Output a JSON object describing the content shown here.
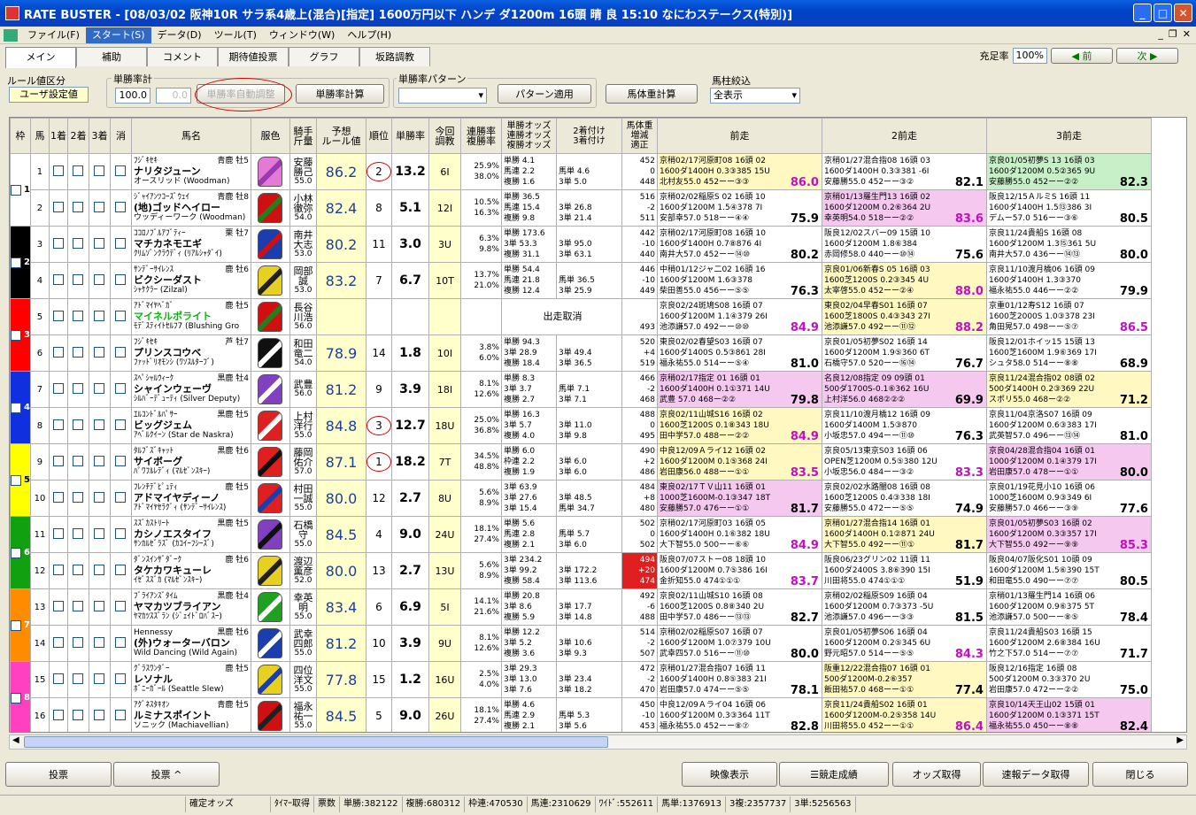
{
  "window": {
    "title": "RATE BUSTER - [08/03/02 阪神10R サラ系4歳上(混合)[指定] 1600万円以下 ハンデ ダ1200m 16頭 晴 良 15:10 なにわステークス(特別)]"
  },
  "menu": [
    "ファイル(F)",
    "スタート(S)",
    "データ(D)",
    "ツール(T)",
    "ウィンドウ(W)",
    "ヘルプ(H)"
  ],
  "menu_active": "スタート(S)",
  "tabs": [
    "メイン",
    "補助",
    "コメント",
    "期待値投票",
    "グラフ",
    "坂路調教"
  ],
  "topright": {
    "label": "充足率",
    "value": "100%",
    "prev": "◀ 前",
    "next": "次 ▶"
  },
  "controls": {
    "rule_label": "ルール値区分",
    "rule_value": "ユーザ設定値",
    "rate_label": "単勝率計",
    "rate_value": "100.0",
    "rate_value2": "0.0",
    "auto_button": "単勝率自動調整",
    "calc_button": "単勝率計算",
    "pattern_label": "単勝率パターン",
    "pattern_apply": "パターン適用",
    "weight_button": "馬体重計算",
    "filter_label": "馬柱絞込",
    "filter_value": "全表示"
  },
  "headers": [
    "枠",
    "馬",
    "1着",
    "2着",
    "3着",
    "消",
    "馬名",
    "服色",
    "騎手\n斤量",
    "予想\nルール値",
    "順位",
    "単勝率",
    "今回\n調教",
    "連勝率\n複勝率",
    "単勝オッズ\n連勝オッズ\n複勝オッズ",
    "2着付け\n3着付け",
    "馬体重\n増減\n適正",
    "前走",
    "2前走",
    "3前走"
  ],
  "horses": [
    {
      "waku": "1",
      "wcolor": "#ffffff",
      "wtext": "#000",
      "num": "1",
      "sire": "ﾌｼﾞｷｾｷ",
      "sex": "青鹿 牡5",
      "name": "ナリタジューン",
      "dam": "オースリッド (Woodman)",
      "jockey": "安藤\n勝己",
      "kin": "55.0",
      "rule": "86.2",
      "rank": "2",
      "rank_circle": true,
      "rate": "13.2",
      "chokyo": "6I",
      "ren": "25.9%\n38.0%",
      "odds": "単勝 4.1\n馬連 2.2\n複勝 1.6",
      "tsuke": "\n馬単 4.6\n3単 5.0",
      "weight": "452\n0\n448",
      "wcolor2": "",
      "silk": [
        "#e27ad6",
        "#9a3ab0"
      ],
      "r1": "京稍02/17河原町08 16頭 02\n1600ダ1400H 0.3③385 15U\n北村友55.0 452ーー③③",
      "p1": "86.0",
      "c1": "#fff8c0",
      "r2": "京稍01/27混合指08 16頭 03\n1600ダ1400H 0.3③381 -6I\n安藤勝55.0 452ーー③②",
      "p2": "82.1",
      "c2": "#ffffff",
      "r3": "京良01/05初夢S 13 16頭 03\n1600ダ1200M 0.5②365 9U\n安藤勝55.0 452ーー②②",
      "p3": "82.3",
      "c3": "#c8f0c8"
    },
    {
      "waku": "1",
      "wcolor": "#ffffff",
      "wtext": "#000",
      "num": "2",
      "sire": "ｼﾞｬｲｱﾝﾂｺｰｽﾞｳｪｲ",
      "sex": "青鹿 牡8",
      "name": "(地)ゴッドヘイロー",
      "dam": "ウッディーワーク (Woodman)",
      "jockey": "小林\n徹弥",
      "kin": "54.0",
      "rule": "82.4",
      "rank": "8",
      "rank_circle": false,
      "rate": "5.1",
      "chokyo": "12I",
      "ren": "10.5%\n16.3%",
      "odds": "単勝 36.5\n馬連 15.4\n複勝 9.8",
      "tsuke": "\n3単 26.8\n3単 21.4",
      "weight": "516\n-2\n511",
      "wcolor2": "",
      "silk": [
        "#d01010",
        "#208020"
      ],
      "r1": "京稍02/02稲原S 02 16頭 10\n1600ダ1200M 1.5④378 7I\n安部幸57.0 518ーー④④",
      "p1": "75.9",
      "c1": "#ffffff",
      "r2": "京稍01/13羅生門13 16頭 02\n1600ダ1200M 0.2⑥364 2U\n幸英明54.0 518ーー②②",
      "p2": "83.6",
      "c2": "#f5c8f0",
      "r3": "阪良12/15ＡルミS 16頭 11\n1600ダ1400H 1.5⑬386 3I\nデムー57.0 516ーー③⑥",
      "p3": "80.5",
      "c3": "#ffffff"
    },
    {
      "waku": "2",
      "wcolor": "#000000",
      "wtext": "#fff",
      "num": "3",
      "sire": "ｺｺﾛﾉﾌﾞﾙｱﾌﾞﾃｨｰ",
      "sex": "栗 牡7",
      "name": "マチカネモエギ",
      "dam": "ｸﾘﾑｿﾞﾝｸﾗｳﾃﾞｨ (ﾘｱﾙｼｬﾀﾞｲ)",
      "jockey": "南井\n大志",
      "kin": "53.0",
      "rule": "80.2",
      "rank": "11",
      "rank_circle": false,
      "rate": "3.0",
      "chokyo": "3U",
      "ren": "6.3%\n9.8%",
      "odds": "単勝 173.6\n3単 53.3\n複勝 31.1",
      "tsuke": "\n3単 95.0\n3単 63.1",
      "weight": "442\n-10\n440",
      "wcolor2": "",
      "silk": [
        "#1a3db0",
        "#d01010"
      ],
      "r1": "京稍02/17河原町08 16頭 10\n1600ダ1400H 0.7⑧876 4I\n南井大57.0 452ーー⑭⑩",
      "p1": "80.2",
      "c1": "#ffffff",
      "r2": "阪良12/02スバー09 15頭 10\n1600ダ1200M 1.8⑥384\n赤岡修58.0 440ーー⑩⑭",
      "p2": "75.6",
      "c2": "#ffffff",
      "r3": "京良11/24貴船S 16頭 08\n1600ダ1200M 1.3⑮361 5U\n南井大57.0 436ーー⑭⑬",
      "p3": "80.0",
      "c3": "#ffffff"
    },
    {
      "waku": "2",
      "wcolor": "#000000",
      "wtext": "#fff",
      "num": "4",
      "sire": "ｻﾝﾃﾞｰｻｲﾚﾝｽ",
      "sex": "鹿 牡6",
      "name": "ビクシーダスト",
      "dam": "ｼｬｹｸﾗｰ (Zilzal)",
      "jockey": "岡部\n誠",
      "kin": "53.0",
      "rule": "83.2",
      "rank": "7",
      "rank_circle": false,
      "rate": "6.7",
      "chokyo": "10T",
      "ren": "13.7%\n21.0%",
      "odds": "単勝 54.4\n馬連 21.8\n複勝 12.4",
      "tsuke": "\n馬単 36.5\n3単 25.9",
      "weight": "446\n-10\n449",
      "wcolor2": "",
      "silk": [
        "#e8d020",
        "#202020"
      ],
      "r1": "中稍01/12ジャ二02 16頭 16\n1600ダ1200M 1.6③378\n柴田善55.0 456ーー⑤⑤",
      "p1": "76.3",
      "c1": "#ffffff",
      "r2": "京良01/06新春S 05 16頭 03\n1600芝1200S 0.2③345 4U\n太宰啓55.0 452ーー②④",
      "p2": "88.0",
      "c2": "#fff8c0",
      "r3": "京良11/10渡月橋06 16頭 09\n1600ダ1400H 1.3③370\n福永祐55.0 446ーー②②",
      "p3": "79.9",
      "c3": "#ffffff"
    },
    {
      "waku": "3",
      "wcolor": "#ff0000",
      "wtext": "#fff",
      "num": "5",
      "sire": "ｱﾄﾞﾏｲﾔﾍﾞｶﾞ",
      "sex": "鹿 牡5",
      "name": "マイネルポライト",
      "dam": "ﾓﾃﾞｽﾃｨｲﾄｾﾙﾌ7 (Blushing Gro",
      "jockey": "長谷\n川浩",
      "kin": "56.0",
      "rule": "",
      "rank": "",
      "rank_circle": false,
      "rate": "",
      "chokyo": "",
      "ren": "",
      "odds": "出走取消",
      "tsuke": "",
      "weight": "\n\n493",
      "wcolor2": "",
      "silk": [
        "#d01010",
        "#208020"
      ],
      "r1": "京良02/24斑鳩S08 16頭 07\n1600ダ1200M 1.1④379 26I\n池添謙57.0 492ーー⑩⑩",
      "p1": "84.9",
      "c1": "#ffffff",
      "r2": "東良02/04早春S01 16頭 07\n1600芝1800S 0.4③343 27I\n池添謙57.0 492ーー⑪⑫",
      "p2": "88.2",
      "c2": "#fff8c0",
      "r3": "京重01/12寿S12 16頭 07\n1600芝2000S 1.0③378 23I\n角田晃57.0 498ーー⑤⑦",
      "p3": "86.5",
      "c3": "#ffffff"
    },
    {
      "waku": "3",
      "wcolor": "#ff0000",
      "wtext": "#fff",
      "num": "6",
      "sire": "ﾌｼﾞｷｾｷ",
      "sex": "芦 牡7",
      "name": "プリンスコウベ",
      "dam": "ﾌｧｯﾄﾞﾘｵﾓﾝｼ (ﾜｿｽﾙﾀｰﾌﾞ)",
      "jockey": "和田\n竜二",
      "kin": "54.0",
      "rule": "78.9",
      "rank": "14",
      "rank_circle": false,
      "rate": "1.8",
      "chokyo": "10I",
      "ren": "3.8%\n6.0%",
      "odds": "単勝 94.3\n3単 28.9\n複勝 18.4",
      "tsuke": "\n3単 49.4\n3単 36.5",
      "weight": "520\n+4\n519",
      "wcolor2": "",
      "silk": [
        "#101010",
        "#ffffff"
      ],
      "r1": "東良02/02春望S03 16頭 07\n1600ダ1400S 0.5③861 28I\n福永祐55.0 514ーー⑤④",
      "p1": "81.0",
      "c1": "#ffffff",
      "r2": "京良01/05初夢S02 16頭 14\n1600ダ1200M 1.9⑤360 6T\n石橋守57.0 520ーー⑯⑭",
      "p2": "76.7",
      "c2": "#ffffff",
      "r3": "阪良12/01ホイッ15 15頭 13\n1600芝1600M 1.9⑥369 17I\nシュタ58.0 514ーー⑧⑧",
      "p3": "68.9",
      "c3": "#ffffff"
    },
    {
      "waku": "4",
      "wcolor": "#1030e0",
      "wtext": "#fff",
      "num": "7",
      "sire": "ｽﾍﾟｼｬﾙｳｨｰｸ",
      "sex": "黒鹿 牡4",
      "name": "シャインウェーヴ",
      "dam": "ｼﾙﾊﾞｰﾃﾞｭｰﾃｨ (Silver Deputy)",
      "jockey": "武豊",
      "kin": "56.0",
      "rule": "81.2",
      "rank": "9",
      "rank_circle": false,
      "rate": "3.9",
      "chokyo": "18I",
      "ren": "8.1%\n12.6%",
      "odds": "単勝 8.3\n3単 3.7\n複勝 2.7",
      "tsuke": "\n馬単 7.1\n3単 7.1",
      "weight": "466\n-2\n468",
      "wcolor2": "",
      "silk": [
        "#8040c0",
        "#ffffff"
      ],
      "r1": "京稍02/17指定 01 16頭 01\n1600ダ1400H 0.1①371 14U\n武豊 57.0 468ー②②",
      "p1": "79.8",
      "c1": "#f5c8f0",
      "r2": "名良12/08指定 09 09頭 01\n500ダ1700S-0.1⑥362 16U\n上村洋56.0 468②②②",
      "p2": "69.9",
      "c2": "#f5c8f0",
      "r3": "京良11/24混合指02 08頭 02\n500ダ1400H 0.2③369 22U\nスポリ55.0 468ー②②",
      "p3": "71.2",
      "c3": "#fff8c0"
    },
    {
      "waku": "4",
      "wcolor": "#1030e0",
      "wtext": "#fff",
      "num": "8",
      "sire": "ｴﾙｺﾝﾄﾞﾙﾊﾟｻｰ",
      "sex": "黒鹿 牡5",
      "name": "ビッグジェム",
      "dam": "ｱﾍﾞﾙｸｲｰﾝ (Star de Naskra)",
      "jockey": "上村\n洋行",
      "kin": "55.0",
      "rule": "84.8",
      "rank": "3",
      "rank_circle": true,
      "rate": "12.7",
      "chokyo": "18U",
      "ren": "25.0%\n36.8%",
      "odds": "単勝 16.3\n3単 5.7\n複勝 4.0",
      "tsuke": "\n3単 11.0\n3単 9.8",
      "weight": "488\n0\n495",
      "wcolor2": "",
      "silk": [
        "#e02020",
        "#ffffff"
      ],
      "r1": "京良02/11山城S16 16頭 02\n1600芝1200S 0.1⑧343 18U\n田中学57.0 488ーー②②",
      "p1": "84.9",
      "c1": "#fff8c0",
      "r2": "京良11/10渡月橋12 16頭 09\n1600ダ1400M 1.5③870\n小坂忠57.0 494ーー⑪⑩",
      "p2": "76.3",
      "c2": "#ffffff",
      "r3": "京良11/04京洛S07 16頭 09\n1600ダ1200M 0.6③383 17I\n武英智57.0 496ーー⑬⑭",
      "p3": "81.0",
      "c3": "#ffffff"
    },
    {
      "waku": "5",
      "wcolor": "#ffff00",
      "wtext": "#000",
      "num": "9",
      "sire": "ﾀﾙﾌﾞｽﾞｷｬｯﾄ",
      "sex": "黒鹿 牡6",
      "name": "サイボーグ",
      "dam": "ﾊﾟﾜﾌﾙﾚﾃﾞｨ (ﾏﾙｾﾞﾝｽｷｰ)",
      "jockey": "藤岡\n佑介",
      "kin": "57.0",
      "rule": "87.1",
      "rank": "1",
      "rank_circle": true,
      "rate": "18.2",
      "chokyo": "7T",
      "ren": "34.5%\n48.8%",
      "odds": "単勝 6.0\n枠連 2.2\n複勝 1.9",
      "tsuke": "\n3単 6.0\n3単 6.0",
      "weight": "490\n+2\n486",
      "wcolor2": "",
      "silk": [
        "#e02020",
        "#101010"
      ],
      "r1": "中良12/09Ａライ12 16頭 02\n1600ダ1200M 0.1⑤368 24I\n岩田康56.0 488ーー①①",
      "p1": "83.5",
      "c1": "#fff8c0",
      "r2": "京良05/13東京S03 16頭 06\nOPEN芝1200M 0.5⑤380 12U\n小坂忠56.0 484ーー③②",
      "p2": "83.3",
      "c2": "#ffffff",
      "r3": "京良04/28混合指04 16頭 01\n1000ダ1200M 0.1④379 17I\n岩田康57.0 478ーー①①",
      "p3": "80.0",
      "c3": "#f5c8f0"
    },
    {
      "waku": "5",
      "wcolor": "#ffff00",
      "wtext": "#000",
      "num": "10",
      "sire": "ﾌﾚﾝﾁﾃﾞﾋﾟｭﾃｨ",
      "sex": "鹿 牡5",
      "name": "アドマイヤディーノ",
      "dam": "ｱﾄﾞﾏｲﾔｾﾗｸﾞｨ (ｻﾝﾃﾞｰｻｲﾚﾝｽ)",
      "jockey": "村田\n一誠",
      "kin": "55.0",
      "rule": "80.0",
      "rank": "12",
      "rank_circle": false,
      "rate": "2.7",
      "chokyo": "8U",
      "ren": "5.6%\n8.9%",
      "odds": "3単 63.9\n3単 27.6\n3単 15.4",
      "tsuke": "\n3単 48.5\n馬単 34.7",
      "weight": "484\n+8\n480",
      "wcolor2": "",
      "silk": [
        "#e02020",
        "#1a3db0"
      ],
      "r1": "東良02/17ＴＶ山11 16頭 01\n1000芝1600M-0.1③347 18T\n安藤勝57.0 476ーー①①",
      "p1": "81.7",
      "c1": "#f5c8f0",
      "r2": "京良02/02水路闇08 16頭 08\n1600芝1200S 0.4③338 18I\n安藤勝55.0 472ーー⑤⑤",
      "p2": "74.9",
      "c2": "#ffffff",
      "r3": "京良01/19花見小10 16頭 06\n1000芝1600M 0.9③349 6I\n安藤勝57.0 466ーー③⑨",
      "p3": "77.6",
      "c3": "#ffffff"
    },
    {
      "waku": "6",
      "wcolor": "#10a010",
      "wtext": "#fff",
      "num": "11",
      "sire": "ｽｽﾞｶｽﾄﾘｰﾄ",
      "sex": "黒鹿 牡5",
      "name": "カシノエスタイフ",
      "dam": "ｻﾝｶﾙｾﾞﾗｽﾞ (ｶｺｲｰﾌｼｰｽﾞ)",
      "jockey": "石橋\n守",
      "kin": "55.0",
      "rule": "84.5",
      "rank": "4",
      "rank_circle": false,
      "rate": "9.0",
      "chokyo": "24U",
      "ren": "18.1%\n27.4%",
      "odds": "単勝 5.6\n馬連 2.8\n複勝 2.1",
      "tsuke": "\n馬単 5.7\n3単 6.0",
      "weight": "502\n0\n502",
      "wcolor2": "",
      "silk": [
        "#8040c0",
        "#101010"
      ],
      "r1": "京稍02/17河原町03 16頭 05\n1600ダ1400H 0.1⑥382 18U\n大下智55.0 500ーー⑥⑥",
      "p1": "84.9",
      "c1": "#ffffff",
      "r2": "京稍01/27混合指14 16頭 01\n1600ダ1400H 0.1②871 24U\n大下智55.0 492ーー⑪①",
      "p2": "81.7",
      "c2": "#fff8c0",
      "r3": "京良01/05初夢S03 16頭 02\n1600ダ1200M 0.3③357 17I\n大下智55.0 492ーー⑨⑨",
      "p3": "85.3",
      "c3": "#f5c8f0"
    },
    {
      "waku": "6",
      "wcolor": "#10a010",
      "wtext": "#fff",
      "num": "12",
      "sire": "ﾀﾞﾝｽｲﾝｻﾞﾀﾞｰｸ",
      "sex": "鹿 牡6",
      "name": "タケカワキューレ",
      "dam": "ｲｾﾞｽｽﾞｶ (ﾏﾙｾﾞﾝｽｷｰ)",
      "jockey": "渡辺\n薫彦",
      "kin": "52.0",
      "rule": "80.0",
      "rank": "13",
      "rank_circle": false,
      "rate": "2.7",
      "chokyo": "13U",
      "ren": "5.6%\n8.9%",
      "odds": "3単 234.2\n3単 99.2\n複勝 58.4",
      "tsuke": "\n3単 172.2\n3単 113.6",
      "weight": "494\n+20\n474",
      "wcolor2": "#e02020",
      "silk": [
        "#e8d020",
        "#202020"
      ],
      "r1": "阪良07/07ストー08 18頭 10\n1600ダ1200M 0.7⑤386 16I\n金折知55.0 474①①①",
      "p1": "83.7",
      "c1": "#ffffff",
      "r2": "阪良06/23グリン02 11頭 11\n1600ダ2400S 3.8⑥390 15I\n川田将55.0 474①①①",
      "p2": "51.9",
      "c2": "#ffffff",
      "r3": "阪良04/07阪化S01 10頭 09\n1600ダ1200M 1.5⑥390 15T\n和田竜55.0 490ーー⑦⑦",
      "p3": "80.5",
      "c3": "#ffffff"
    },
    {
      "waku": "7",
      "wcolor": "#ff8c00",
      "wtext": "#fff",
      "num": "13",
      "sire": "ﾌﾞﾗｲｱﾝｽﾞﾀｲﾑ",
      "sex": "黒鹿 牡4",
      "name": "ヤマカツブライアン",
      "dam": "ﾔﾏｶﾂｽｽﾞﾗﾝ (ｼﾞｪｲﾄﾞﾛﾊﾞｽｰ)",
      "jockey": "幸英\n明",
      "kin": "55.0",
      "rule": "83.4",
      "rank": "6",
      "rank_circle": false,
      "rate": "6.9",
      "chokyo": "5I",
      "ren": "14.1%\n21.6%",
      "odds": "単勝 20.8\n3単 8.6\n複勝 5.9",
      "tsuke": "\n3単 17.7\n3単 14.8",
      "weight": "492\n-6\n488",
      "wcolor2": "",
      "silk": [
        "#20a020",
        "#ffffff"
      ],
      "r1": "京良02/11山城S10 16頭 08\n1600芝1200S 0.8⑧340 2U\n田中学57.0 486ーー⑬⑬",
      "p1": "82.7",
      "c1": "#ffffff",
      "r2": "京稍02/02稲原S09 16頭 04\n1600ダ1200M 0.7③373 -5U\n池添謙57.0 496ーー③③",
      "p2": "81.5",
      "c2": "#ffffff",
      "r3": "京稍01/13羅生門14 16頭 06\n1600ダ1200M 0.9⑥375 5T\n池添謙57.0 500ーー⑧⑤",
      "p3": "78.4",
      "c3": "#ffffff"
    },
    {
      "waku": "7",
      "wcolor": "#ff8c00",
      "wtext": "#fff",
      "num": "14",
      "sire": "Hennessy",
      "sex": "黒鹿 牡6",
      "name": "(外)ウォーターバロン",
      "dam": "Wild Dancing (Wild Again)",
      "jockey": "武幸\n四郎",
      "kin": "55.0",
      "rule": "81.2",
      "rank": "10",
      "rank_circle": false,
      "rate": "3.9",
      "chokyo": "9U",
      "ren": "8.1%\n12.6%",
      "odds": "単勝 12.2\n3単 5.2\n複勝 3.6",
      "tsuke": "\n3単 10.6\n3単 9.3",
      "weight": "514\n-2\n507",
      "wcolor2": "",
      "silk": [
        "#1a3db0",
        "#ffffff"
      ],
      "r1": "京稍02/02稲原S07 16頭 07\n1600ダ1200M 1.0⑦379 10U\n武幸四57.0 516ーー⑪⑩",
      "p1": "80.0",
      "c1": "#ffffff",
      "r2": "京良01/05初夢S06 16頭 04\n1600ダ1200M 0.2⑤345 6U\n野元昭57.0 514ーー⑤⑤",
      "p2": "84.3",
      "c2": "#ffffff",
      "r3": "京良11/24貴船S03 16頭 15\n1600ダ1200M 2.6⑧384 16U\n竹之下57.0 514ーー⑦⑦",
      "p3": "71.7",
      "c3": "#ffffff"
    },
    {
      "waku": "8",
      "wcolor": "#ff40c0",
      "wtext": "#fff",
      "num": "15",
      "sire": "ｸﾞﾗｽﾜﾝﾀﾞｰ",
      "sex": "鹿 牡5",
      "name": "レソナル",
      "dam": "ﾎﾞﾆｰｶﾞｰﾙ (Seattle Slew)",
      "jockey": "四位\n洋文",
      "kin": "55.0",
      "rule": "77.8",
      "rank": "15",
      "rank_circle": false,
      "rate": "1.2",
      "chokyo": "16U",
      "ren": "2.5%\n4.0%",
      "odds": "3単 29.3\n3単 13.0\n3単 7.6",
      "tsuke": "\n3単 23.4\n3単 18.2",
      "weight": "472\n-2\n470",
      "wcolor2": "",
      "silk": [
        "#e8d020",
        "#1a3db0"
      ],
      "r1": "京稍01/27混合指07 16頭 11\n1600ダ1400H 0.8⑤383 21I\n岩田康57.0 474ーー⑤⑤",
      "p1": "78.1",
      "c1": "#ffffff",
      "r2": "阪重12/22混合指07 16頭 01\n500ダ1200M-0.2⑥357\n飯田祐57.0 468ーー①①",
      "p2": "77.4",
      "c2": "#fff8c0",
      "r3": "阪良12/16指定 16頭 08\n500ダ1200M 0.3③370 2U\n岩田康57.0 472ーー②②",
      "p3": "75.0",
      "c3": "#ffffff"
    },
    {
      "waku": "8",
      "wcolor": "#ff40c0",
      "wtext": "#fff",
      "num": "16",
      "sire": "ｱｸﾞﾈｽﾀｷｵﾝ",
      "sex": "青鹿 牡5",
      "name": "ルミナスポイント",
      "dam": "ソニック (Machiavellian)",
      "jockey": "福永\n祐一",
      "kin": "55.0",
      "rule": "84.5",
      "rank": "5",
      "rank_circle": false,
      "rate": "9.0",
      "chokyo": "26U",
      "ren": "18.1%\n27.4%",
      "odds": "単勝 4.6\n馬連 2.9\n複勝 2.1",
      "tsuke": "\n馬単 5.3\n3単 5.6",
      "weight": "450\n-10\n453",
      "wcolor2": "",
      "silk": [
        "#d01010",
        "#202020"
      ],
      "r1": "中良12/09Ａライ04 16頭 06\n1600ダ1200M 0.3③364 11T\n福永祐55.0 452ーー⑧⑦",
      "p1": "82.8",
      "c1": "#ffffff",
      "r2": "京良11/24貴船S02 16頭 01\n1600ダ1200M-0.2⑤358 14U\n川田将55.0 452ーー①①",
      "p2": "86.4",
      "c2": "#fff8c0",
      "r3": "京良10/14天王山02 15頭 01\n1600ダ1200M 0.1③371 15T\n福永祐55.0 450ーー⑧⑧",
      "p3": "82.4",
      "c3": "#f5c8f0"
    }
  ],
  "bottom_buttons": [
    "投票",
    "投票 ^",
    "映像表示",
    "競走成績",
    "オッズ取得",
    "速報データ取得",
    "閉じる"
  ],
  "status": [
    "確定オッズ",
    "ﾀｲﾏｰ取得",
    "票数",
    "単勝:382122",
    "複勝:680312",
    "枠連:470530",
    "馬連:2310629",
    "ﾜｲﾄﾞ:552611",
    "馬単:1376913",
    "3複:2357737",
    "3単:5256563"
  ]
}
